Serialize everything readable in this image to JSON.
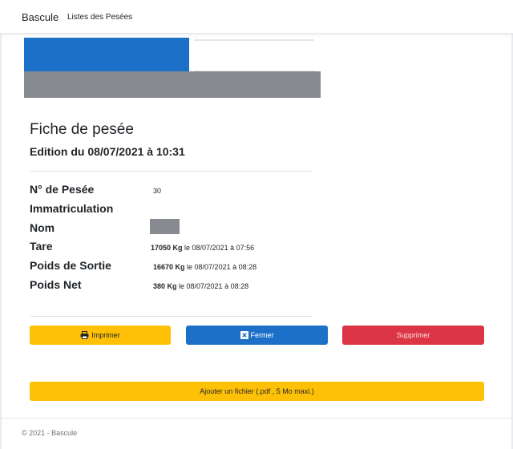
{
  "navbar": {
    "brand": "Bascule",
    "links": [
      "Listes des Pesées"
    ]
  },
  "header": {
    "title": "Fiche de pesée",
    "subtitle": "Edition du 08/07/2021 à 10:31"
  },
  "details": {
    "numero_label": "N° de Pesée",
    "numero_value": "30",
    "immatriculation_label": "Immatriculation",
    "nom_label": "Nom",
    "tare_label": "Tare",
    "tare_weight": "17050 Kg",
    "tare_date": " le 08/07/2021 à 07:56",
    "sortie_label": "Poids de Sortie",
    "sortie_weight": "16670 Kg",
    "sortie_date": " le 08/07/2021 à 08:28",
    "net_label": "Poids Net",
    "net_weight": "380 Kg",
    "net_date": " le 08/07/2021 à 08:28"
  },
  "actions": {
    "print_label": "Imprimer",
    "close_label": "Fermer",
    "delete_label": "Supprimer",
    "add_file_label": "Ajouter un fichier (.pdf , 5 Mo maxi.)"
  },
  "footer": {
    "text": "© 2021 - Bascule"
  },
  "colors": {
    "primary": "#1c70c8",
    "warning": "#ffc107",
    "danger": "#dc3545",
    "redacted": "#878a91"
  },
  "icons": {
    "print": "printer-icon",
    "close": "close-square-icon"
  }
}
